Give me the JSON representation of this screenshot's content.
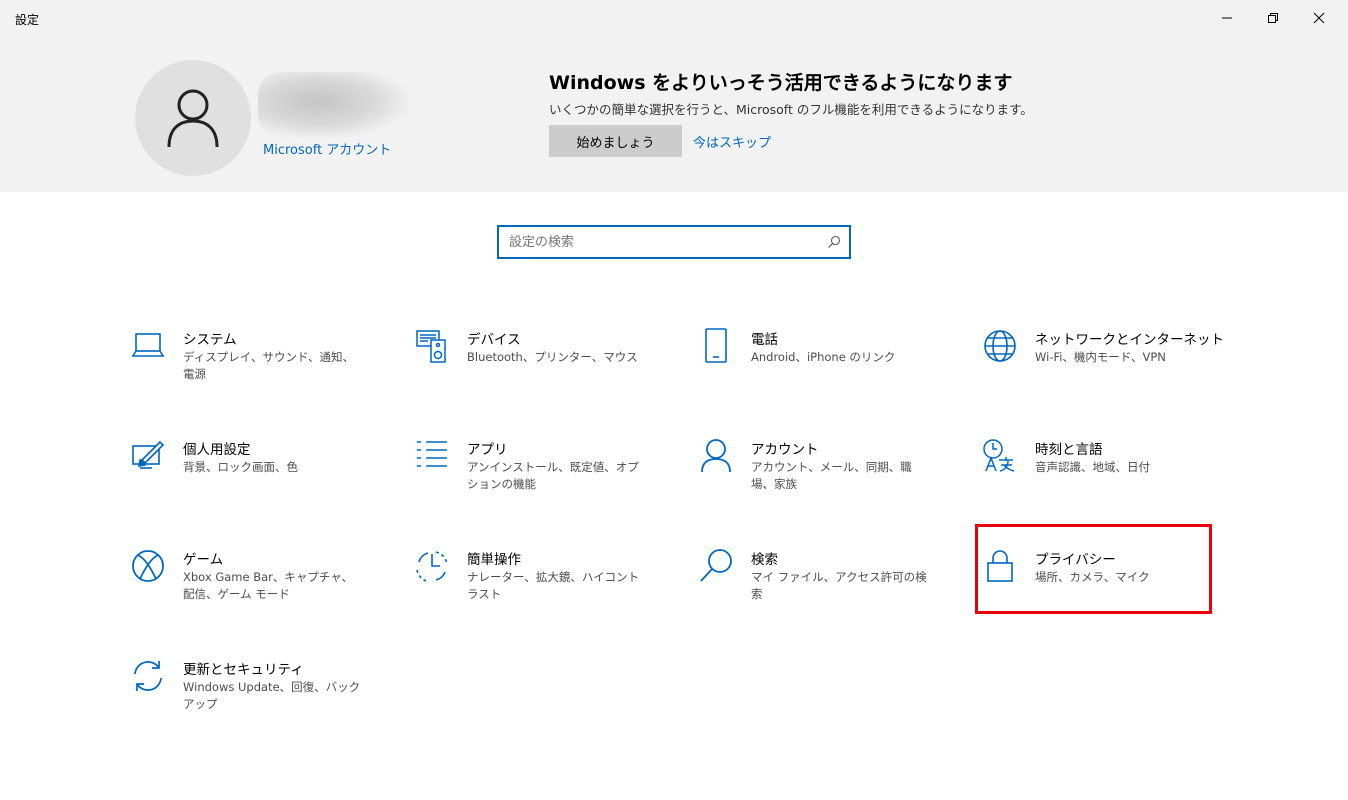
{
  "window": {
    "title": "設定"
  },
  "account": {
    "link_label": "Microsoft アカウント"
  },
  "promo": {
    "title": "Windows をよりいっそう活用できるようになります",
    "subtitle": "いくつかの簡単な選択を行うと、Microsoft のフル機能を利用できるようになります。",
    "start_label": "始めましょう",
    "skip_label": "今はスキップ"
  },
  "search": {
    "placeholder": "設定の検索"
  },
  "tiles": [
    {
      "title": "システム",
      "desc": "ディスプレイ、サウンド、通知、電源",
      "icon": "laptop-icon"
    },
    {
      "title": "デバイス",
      "desc": "Bluetooth、プリンター、マウス",
      "icon": "devices-icon"
    },
    {
      "title": "電話",
      "desc": "Android、iPhone のリンク",
      "icon": "phone-icon"
    },
    {
      "title": "ネットワークとインターネット",
      "desc": "Wi-Fi、機内モード、VPN",
      "icon": "globe-icon"
    },
    {
      "title": "個人用設定",
      "desc": "背景、ロック画面、色",
      "icon": "personalization-icon"
    },
    {
      "title": "アプリ",
      "desc": "アンインストール、既定値、オプションの機能",
      "icon": "apps-list-icon"
    },
    {
      "title": "アカウント",
      "desc": "アカウント、メール、同期、職場、家族",
      "icon": "person-icon"
    },
    {
      "title": "時刻と言語",
      "desc": "音声認識、地域、日付",
      "icon": "time-language-icon"
    },
    {
      "title": "ゲーム",
      "desc": "Xbox Game Bar、キャプチャ、配信、ゲーム モード",
      "icon": "xbox-icon"
    },
    {
      "title": "簡単操作",
      "desc": "ナレーター、拡大鏡、ハイコントラスト",
      "icon": "ease-of-access-icon"
    },
    {
      "title": "検索",
      "desc": "マイ ファイル、アクセス許可の検索",
      "icon": "magnifier-icon"
    },
    {
      "title": "プライバシー",
      "desc": "場所、カメラ、マイク",
      "icon": "lock-icon"
    },
    {
      "title": "更新とセキュリティ",
      "desc": "Windows Update、回復、バックアップ",
      "icon": "update-arrows-icon"
    }
  ],
  "colors": {
    "accent": "#0067c0",
    "highlight": "#e8000d",
    "banner_bg": "#f2f2f2"
  }
}
